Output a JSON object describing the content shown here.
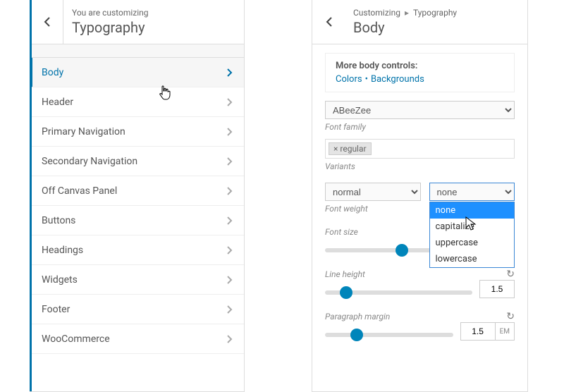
{
  "left": {
    "header_pre": "You are customizing",
    "header_title": "Typography",
    "items": [
      {
        "label": "Body",
        "active": true
      },
      {
        "label": "Header"
      },
      {
        "label": "Primary Navigation"
      },
      {
        "label": "Secondary Navigation"
      },
      {
        "label": "Off Canvas Panel"
      },
      {
        "label": "Buttons"
      },
      {
        "label": "Headings"
      },
      {
        "label": "Widgets"
      },
      {
        "label": "Footer"
      },
      {
        "label": "WooCommerce"
      }
    ]
  },
  "right": {
    "crumb_a": "Customizing",
    "crumb_b": "Typography",
    "header_title": "Body",
    "more": {
      "title": "More body controls:",
      "link_a": "Colors",
      "link_b": "Backgrounds"
    },
    "font_family_value": "ABeeZee",
    "font_family_label": "Font family",
    "variants_tag": "× regular",
    "variants_label": "Variants",
    "weight_value": "normal",
    "weight_label": "Font weight",
    "transform_value": "none",
    "transform_options": [
      "none",
      "capitalize",
      "uppercase",
      "lowercase"
    ],
    "font_size_label": "Font size",
    "line_height_label": "Line height",
    "line_height_value": "1.5",
    "paragraph_margin_label": "Paragraph margin",
    "paragraph_margin_value": "1.5",
    "paragraph_margin_unit": "EM"
  }
}
